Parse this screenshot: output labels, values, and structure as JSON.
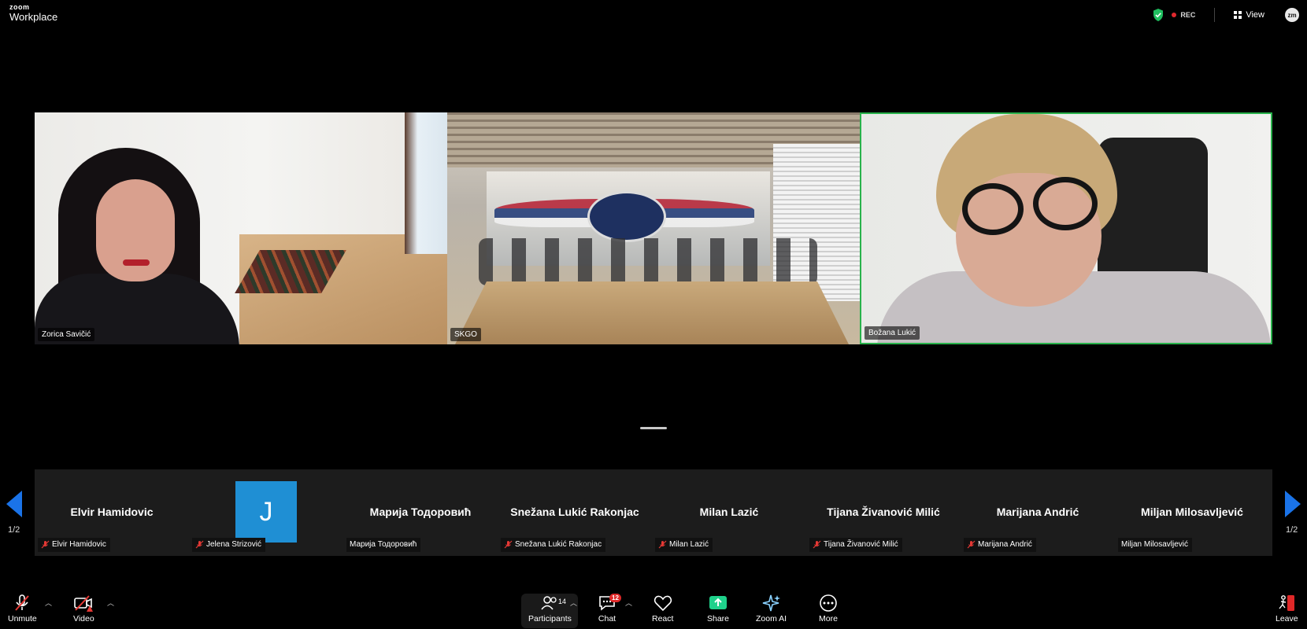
{
  "app": {
    "brand": "zoom",
    "product": "Workplace"
  },
  "header": {
    "rec_label": "REC",
    "view_label": "View",
    "avatar_initials": "zm"
  },
  "main_videos": [
    {
      "name": "Zorica Savičić",
      "active_speaker": false
    },
    {
      "name": "SKGO",
      "active_speaker": false
    },
    {
      "name": "Božana Lukić",
      "active_speaker": true
    }
  ],
  "thumbnails": [
    {
      "title": "Elvir Hamidovic",
      "label": "Elvir Hamidovic",
      "muted": true,
      "avatar": ""
    },
    {
      "title": "",
      "label": "Jelena Strizović",
      "muted": true,
      "avatar": "J"
    },
    {
      "title": "Марија Тодоровић",
      "label": "Марија Тодоровић",
      "muted": false,
      "avatar": ""
    },
    {
      "title": "Snežana Lukić Rakonjac",
      "label": "Snežana Lukić Rakonjac",
      "muted": true,
      "avatar": ""
    },
    {
      "title": "Milan Lazić",
      "label": "Milan Lazić",
      "muted": true,
      "avatar": ""
    },
    {
      "title": "Tijana Živanović Milić",
      "label": "Tijana Živanović Milić",
      "muted": true,
      "avatar": ""
    },
    {
      "title": "Marijana Andrić",
      "label": "Marijana Andrić",
      "muted": true,
      "avatar": ""
    },
    {
      "title": "Miljan Milosavljević",
      "label": "Miljan Milosavljević",
      "muted": false,
      "avatar": ""
    }
  ],
  "pagination": {
    "left": "1/2",
    "right": "1/2"
  },
  "toolbar": {
    "unmute": "Unmute",
    "video": "Video",
    "participants": "Participants",
    "participants_count": "14",
    "chat": "Chat",
    "chat_badge": "12",
    "react": "React",
    "share": "Share",
    "zoom_ai": "Zoom AI",
    "more": "More",
    "leave": "Leave"
  },
  "colors": {
    "accent_blue": "#1a73e8",
    "active_speaker_border": "#28b24b",
    "share_green": "#1fd18b",
    "rec_red": "#e0282e",
    "avatar_blue": "#1f8fd4"
  }
}
